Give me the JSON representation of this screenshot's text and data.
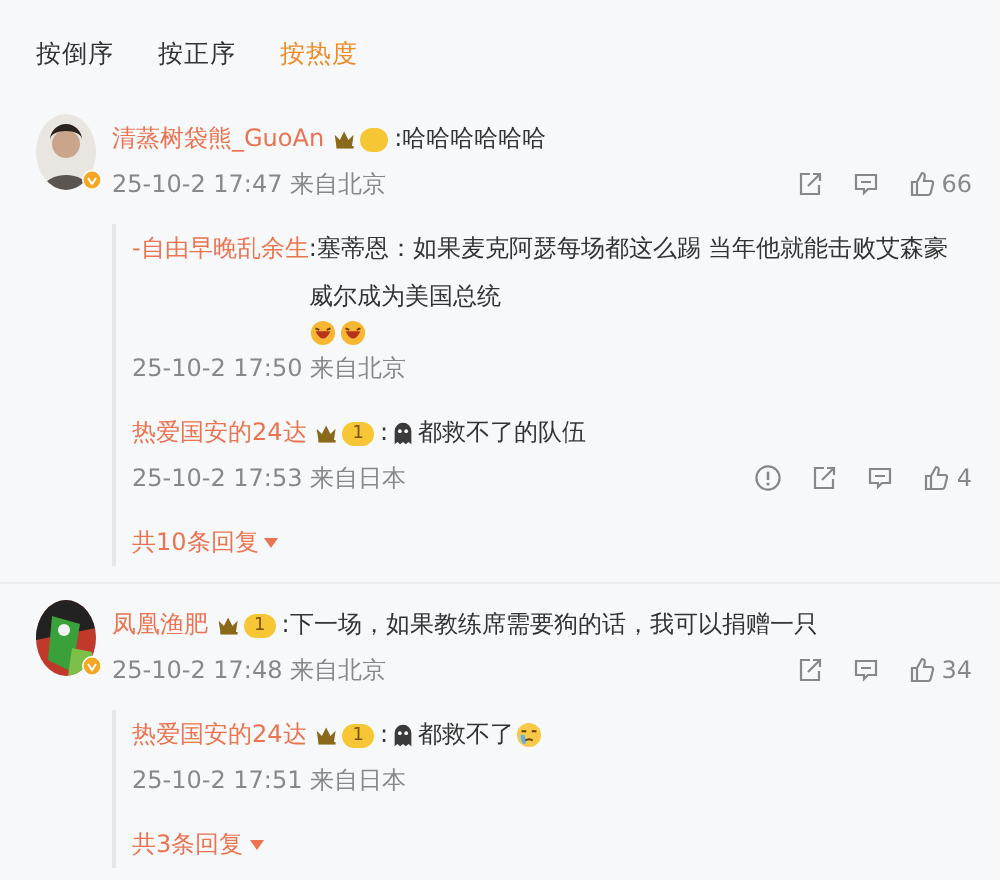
{
  "sort_tabs": [
    {
      "label": "按倒序",
      "selected": false
    },
    {
      "label": "按正序",
      "selected": false
    },
    {
      "label": "按热度",
      "selected": true
    }
  ],
  "comments": [
    {
      "user": "清蒸树袋熊_GuoAn",
      "verified": true,
      "crown": true,
      "text": [
        {
          "kind": "text",
          "text": ":哈哈哈哈哈哈"
        }
      ],
      "time": "25-10-2 17:47",
      "location": "来自北京",
      "actions": [
        {
          "kind": "share"
        },
        {
          "kind": "comment"
        },
        {
          "kind": "like",
          "count": "66"
        }
      ],
      "replies": [
        {
          "user": "-自由早晚乱余生",
          "text": [
            {
              "kind": "text",
              "text": ":塞蒂恩：如果麦克阿瑟每场都这么踢 当年他就能击败艾森豪威尔成为美国总统"
            },
            {
              "kind": "laugh"
            },
            {
              "kind": "laugh"
            }
          ],
          "time": "25-10-2 17:50",
          "location": "来自北京"
        },
        {
          "user": "热爱国安的24达",
          "crown": true,
          "rank": "1",
          "text": [
            {
              "kind": "text",
              "text": ":"
            },
            {
              "kind": "ghost"
            },
            {
              "kind": "text",
              "text": "都救不了的队伍"
            }
          ],
          "time": "25-10-2 17:53",
          "location": "来自日本",
          "actions": [
            {
              "kind": "report"
            },
            {
              "kind": "share"
            },
            {
              "kind": "comment"
            },
            {
              "kind": "like",
              "count": "4"
            }
          ]
        }
      ],
      "more": "共10条回复"
    },
    {
      "user": "凤凰渔肥",
      "verified": true,
      "crown": true,
      "rank": "1",
      "text": [
        {
          "kind": "text",
          "text": ":下一场，如果教练席需要狗的话，我可以捐赠一只"
        }
      ],
      "time": "25-10-2 17:48",
      "location": "来自北京",
      "actions": [
        {
          "kind": "share"
        },
        {
          "kind": "comment"
        },
        {
          "kind": "like",
          "count": "34"
        }
      ],
      "replies": [
        {
          "user": "热爱国安的24达",
          "crown": true,
          "rank": "1",
          "text": [
            {
              "kind": "text",
              "text": ":"
            },
            {
              "kind": "ghost"
            },
            {
              "kind": "text",
              "text": "都救不了"
            },
            {
              "kind": "cry"
            }
          ],
          "time": "25-10-2 17:51",
          "location": "来自日本"
        }
      ],
      "more": "共3条回复"
    }
  ]
}
